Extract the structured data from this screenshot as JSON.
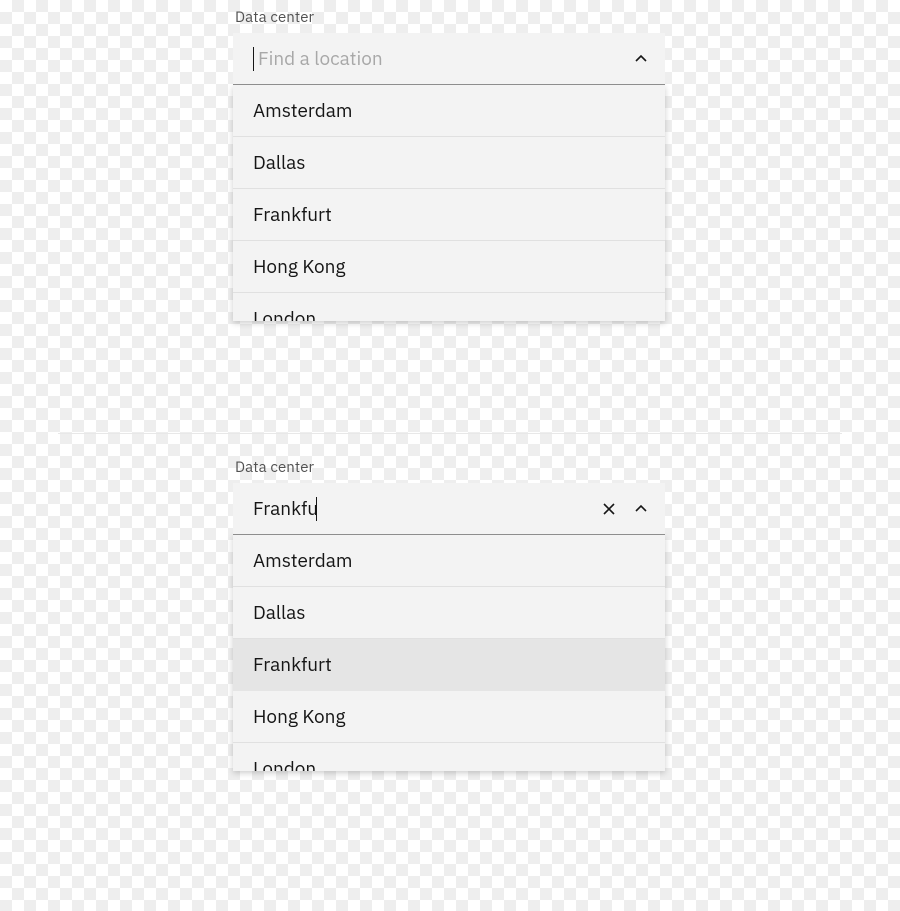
{
  "combo1": {
    "label": "Data center",
    "placeholder": "Find a location",
    "value": "",
    "options": [
      "Amsterdam",
      "Dallas",
      "Frankfurt",
      "Hong Kong",
      "London"
    ]
  },
  "combo2": {
    "label": "Data center",
    "placeholder": "Find a location",
    "value": "Frankfu",
    "options": [
      "Amsterdam",
      "Dallas",
      "Frankfurt",
      "Hong Kong",
      "London"
    ],
    "highlight_index": 2
  }
}
